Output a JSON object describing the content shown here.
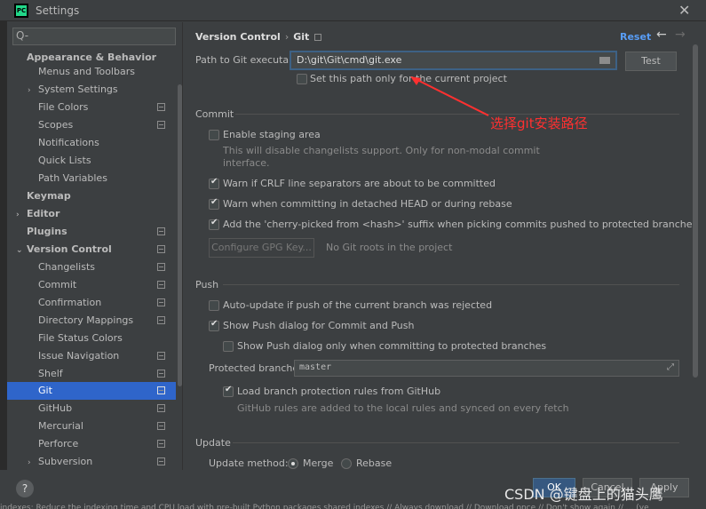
{
  "window": {
    "title": "Settings",
    "app_icon": "PC"
  },
  "sidebar": {
    "search_placeholder": "Q-",
    "items": [
      {
        "label": "Appearance & Behavior"
      },
      {
        "label": "Menus and Toolbars"
      },
      {
        "label": "System Settings",
        "arrow": "›"
      },
      {
        "label": "File Colors"
      },
      {
        "label": "Scopes"
      },
      {
        "label": "Notifications"
      },
      {
        "label": "Quick Lists"
      },
      {
        "label": "Path Variables"
      },
      {
        "label": "Keymap"
      },
      {
        "label": "Editor",
        "arrow": "›"
      },
      {
        "label": "Plugins"
      },
      {
        "label": "Version Control",
        "arrow": "⌄"
      },
      {
        "label": "Changelists"
      },
      {
        "label": "Commit"
      },
      {
        "label": "Confirmation"
      },
      {
        "label": "Directory Mappings"
      },
      {
        "label": "File Status Colors"
      },
      {
        "label": "Issue Navigation"
      },
      {
        "label": "Shelf"
      },
      {
        "label": "Git"
      },
      {
        "label": "GitHub"
      },
      {
        "label": "Mercurial"
      },
      {
        "label": "Perforce"
      },
      {
        "label": "Subversion",
        "arrow": "›"
      }
    ]
  },
  "breadcrumb": {
    "parent": "Version Control",
    "separator": "›",
    "current": "Git"
  },
  "header": {
    "reset": "Reset",
    "back": "←",
    "forward": "→"
  },
  "git": {
    "path_label": "Path to Git executable:",
    "path_value": "D:\\git\\Git\\cmd\\git.exe",
    "test_button": "Test",
    "set_path_only": "Set this path only for the current project"
  },
  "commit": {
    "section": "Commit",
    "staging": "Enable staging area",
    "staging_note_1": "This will disable changelists support. Only for non-modal commit",
    "staging_note_2": "interface.",
    "crlf": "Warn if CRLF line separators are about to be committed",
    "detached": "Warn when committing in detached HEAD or during rebase",
    "cherry": "Add the 'cherry-picked from <hash>' suffix when picking commits pushed to protected branches",
    "gpg_button": "Configure GPG Key...",
    "no_roots": "No Git roots in the project"
  },
  "push": {
    "section": "Push",
    "auto_update": "Auto-update if push of the current branch was rejected",
    "show_dialog": "Show Push dialog for Commit and Push",
    "show_protected": "Show Push dialog only when committing to protected branches",
    "protected_label": "Protected branches:",
    "protected_value": "master",
    "load_rules": "Load branch protection rules from GitHub",
    "rules_note": "GitHub rules are added to the local rules and synced on every fetch"
  },
  "update": {
    "section": "Update",
    "method_label": "Update method:",
    "merge": "Merge",
    "rebase": "Rebase"
  },
  "footer": {
    "help": "?",
    "ok": "OK",
    "cancel": "Cancel",
    "apply": "Apply"
  },
  "statusbar": {
    "text": "indexes: Reduce the indexing time and CPU load with pre-built Python packages shared indexes // Always download // Download once // Don't show again // ... (ye"
  },
  "annotation": {
    "text": "选择git安装路径",
    "color": "#ff3030"
  },
  "watermark": {
    "text": "CSDN @键盘上的猫头鹰"
  }
}
